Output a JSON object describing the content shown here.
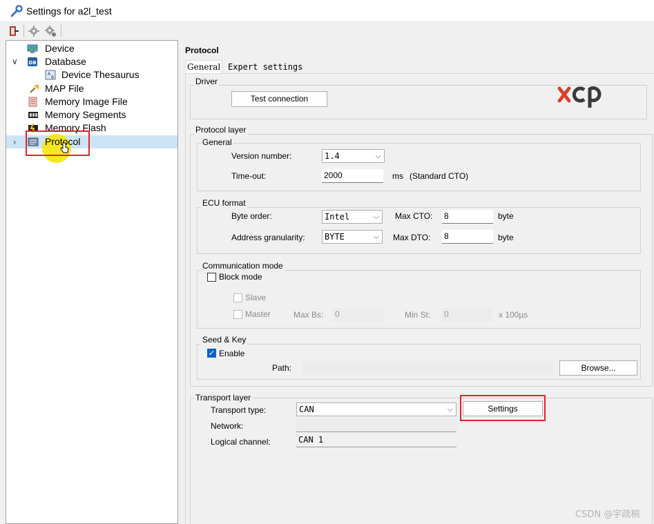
{
  "window": {
    "title": "Settings for a2l_test"
  },
  "toolbar": {
    "icons": [
      "exit-icon",
      "plugin-icon",
      "plugin-settings-icon"
    ]
  },
  "tree": {
    "items": [
      {
        "label": "Device",
        "icon": "device-icon",
        "indent": 1
      },
      {
        "label": "Database",
        "icon": "database-icon",
        "indent": 1,
        "expander": "∨"
      },
      {
        "label": "Device Thesaurus",
        "icon": "thesaurus-icon",
        "indent": 2
      },
      {
        "label": "MAP File",
        "icon": "map-pin-icon",
        "indent": 1
      },
      {
        "label": "Memory Image File",
        "icon": "memory-image-icon",
        "indent": 1
      },
      {
        "label": "Memory Segments",
        "icon": "memory-segments-icon",
        "indent": 1
      },
      {
        "label": "Memory Flash",
        "icon": "memory-flash-icon",
        "indent": 1
      },
      {
        "label": "Protocol",
        "icon": "protocol-icon",
        "indent": 1,
        "expander": "›",
        "selected": true
      }
    ]
  },
  "panel": {
    "heading": "Protocol",
    "tabs": [
      {
        "label": "General",
        "active": true
      },
      {
        "label": "Expert settings",
        "active": false
      }
    ],
    "driver": {
      "title": "Driver",
      "test_button": "Test connection",
      "logo": "xcp"
    },
    "protocol_layer": {
      "title": "Protocol layer",
      "general": {
        "title": "General",
        "version_label": "Version number:",
        "version_value": "1.4",
        "timeout_label": "Time-out:",
        "timeout_value": "2000",
        "timeout_unit": "ms",
        "timeout_note": "(Standard CTO)"
      },
      "ecu_format": {
        "title": "ECU format",
        "byte_order_label": "Byte order:",
        "byte_order_value": "Intel",
        "max_cto_label": "Max CTO:",
        "max_cto_value": "8",
        "max_cto_unit": "byte",
        "addr_gran_label": "Address granularity:",
        "addr_gran_value": "BYTE",
        "max_dto_label": "Max DTO:",
        "max_dto_value": "8",
        "max_dto_unit": "byte"
      },
      "comm_mode": {
        "title": "Communication mode",
        "block_mode_label": "Block mode",
        "slave_label": "Slave",
        "master_label": "Master",
        "max_bs_label": "Max Bs:",
        "max_bs_value": "0",
        "min_st_label": "Min St:",
        "min_st_value": "0",
        "min_st_unit": "x 100µs"
      },
      "seed_key": {
        "title": "Seed & Key",
        "enable_label": "Enable",
        "enable_checked": true,
        "path_label": "Path:",
        "path_value": "",
        "browse_button": "Browse..."
      }
    },
    "transport_layer": {
      "title": "Transport layer",
      "type_label": "Transport type:",
      "type_value": "CAN",
      "settings_button": "Settings",
      "network_label": "Network:",
      "network_value": "",
      "channel_label": "Logical channel:",
      "channel_value": "CAN 1"
    }
  },
  "watermark": "CSDN @宇疏桐",
  "colors": {
    "selection": "#cce4f7",
    "highlight_box": "#e8202a",
    "cursor_halo": "#f5e60a",
    "checkbox_on": "#0a64c8"
  }
}
